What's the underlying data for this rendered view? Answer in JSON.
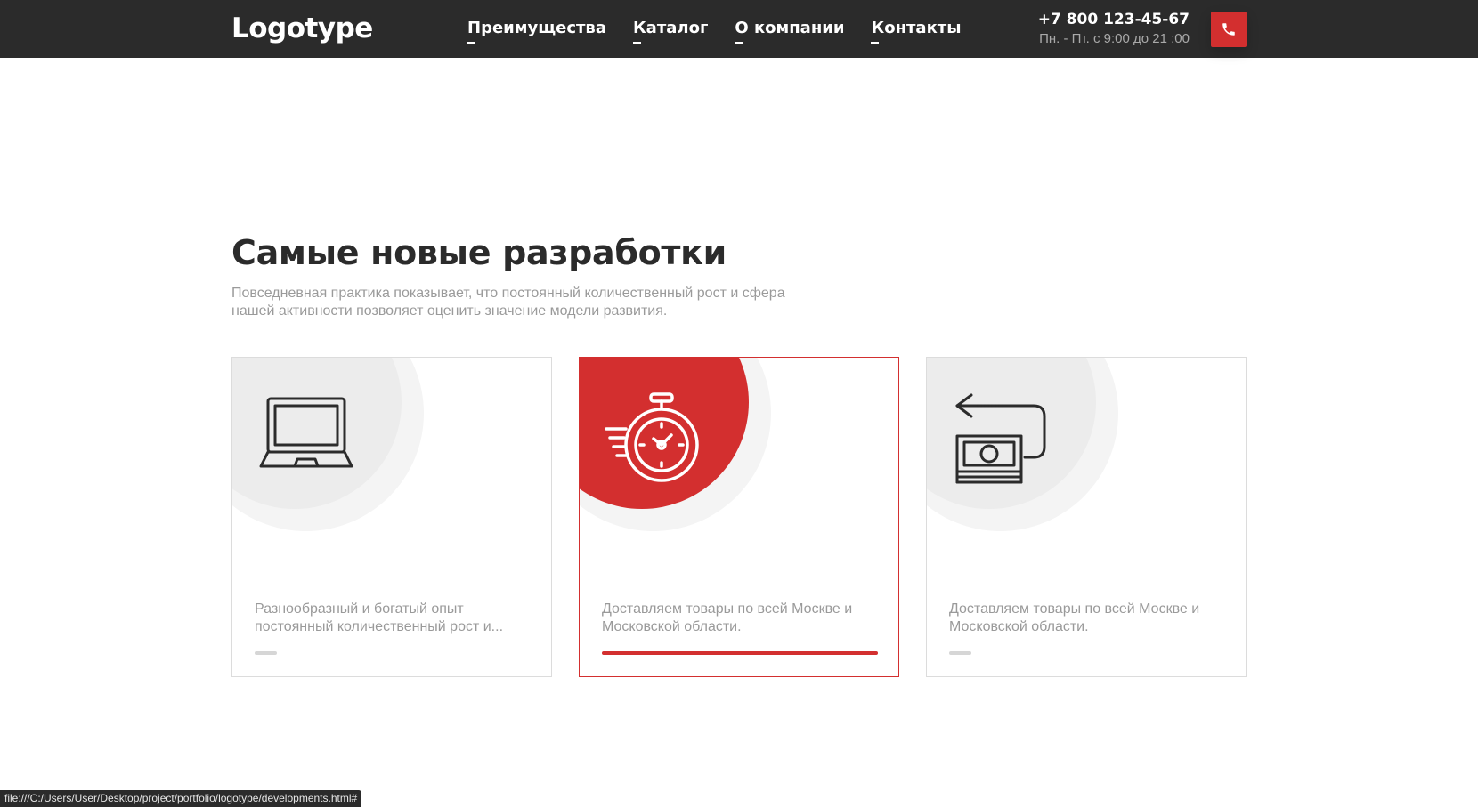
{
  "header": {
    "logo": "Logotype",
    "nav": [
      {
        "label": "Преимущества"
      },
      {
        "label": "Каталог"
      },
      {
        "label": "О компании"
      },
      {
        "label": "Контакты"
      }
    ],
    "phone": "+7 800 123-45-67",
    "hours": "Пн. - Пт. с 9:00 до 21 :00",
    "call_icon": "phone-icon"
  },
  "section": {
    "title": "Самые новые разработки",
    "description": "Повседневная практика показывает, что постоянный количественный рост и сфера нашей активности позволяет оценить значение модели развития."
  },
  "cards": [
    {
      "icon": "laptop-icon",
      "text": "Разнообразный и богатый опыт постоянный количественный рост и...",
      "active": false
    },
    {
      "icon": "stopwatch-icon",
      "text": "Доставляем товары по всей Москве и Московской области.",
      "active": true
    },
    {
      "icon": "money-return-icon",
      "text": "Доставляем товары по всей Москве и Московской области.",
      "active": false
    }
  ],
  "status_bar": {
    "url": "file:///C:/Users/User/Desktop/project/portfolio/logotype/developments.html#"
  },
  "colors": {
    "accent": "#d32f2f",
    "header_bg": "#2b2b2b",
    "muted_text": "#9a9a9a"
  }
}
